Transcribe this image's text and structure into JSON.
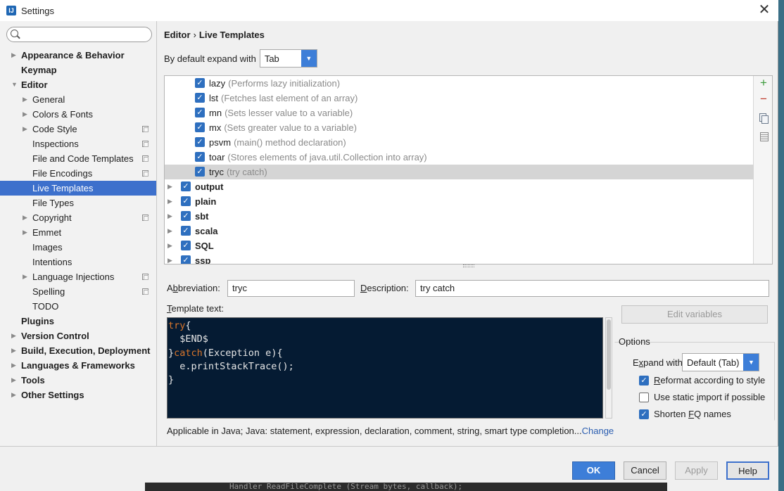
{
  "window": {
    "title": "Settings",
    "app_icon_glyph": "IJ",
    "close_glyph": "✕"
  },
  "search": {
    "placeholder": ""
  },
  "sidebar": {
    "items": [
      {
        "label": "Appearance & Behavior",
        "level": 0,
        "bold": true,
        "arrow": "right",
        "page_icon": false
      },
      {
        "label": "Keymap",
        "level": 0,
        "bold": true,
        "arrow": "none",
        "page_icon": false
      },
      {
        "label": "Editor",
        "level": 0,
        "bold": true,
        "arrow": "down",
        "page_icon": false
      },
      {
        "label": "General",
        "level": 1,
        "bold": false,
        "arrow": "right",
        "page_icon": false
      },
      {
        "label": "Colors & Fonts",
        "level": 1,
        "bold": false,
        "arrow": "right",
        "page_icon": false
      },
      {
        "label": "Code Style",
        "level": 1,
        "bold": false,
        "arrow": "right",
        "page_icon": true
      },
      {
        "label": "Inspections",
        "level": 1,
        "bold": false,
        "arrow": "none",
        "page_icon": true
      },
      {
        "label": "File and Code Templates",
        "level": 1,
        "bold": false,
        "arrow": "none",
        "page_icon": true
      },
      {
        "label": "File Encodings",
        "level": 1,
        "bold": false,
        "arrow": "none",
        "page_icon": true
      },
      {
        "label": "Live Templates",
        "level": 1,
        "bold": false,
        "arrow": "none",
        "page_icon": false,
        "selected": true
      },
      {
        "label": "File Types",
        "level": 1,
        "bold": false,
        "arrow": "none",
        "page_icon": false
      },
      {
        "label": "Copyright",
        "level": 1,
        "bold": false,
        "arrow": "right",
        "page_icon": true
      },
      {
        "label": "Emmet",
        "level": 1,
        "bold": false,
        "arrow": "right",
        "page_icon": false
      },
      {
        "label": "Images",
        "level": 1,
        "bold": false,
        "arrow": "none",
        "page_icon": false
      },
      {
        "label": "Intentions",
        "level": 1,
        "bold": false,
        "arrow": "none",
        "page_icon": false
      },
      {
        "label": "Language Injections",
        "level": 1,
        "bold": false,
        "arrow": "right",
        "page_icon": true
      },
      {
        "label": "Spelling",
        "level": 1,
        "bold": false,
        "arrow": "none",
        "page_icon": true
      },
      {
        "label": "TODO",
        "level": 1,
        "bold": false,
        "arrow": "none",
        "page_icon": false
      },
      {
        "label": "Plugins",
        "level": 0,
        "bold": true,
        "arrow": "none",
        "page_icon": false
      },
      {
        "label": "Version Control",
        "level": 0,
        "bold": true,
        "arrow": "right",
        "page_icon": false
      },
      {
        "label": "Build, Execution, Deployment",
        "level": 0,
        "bold": true,
        "arrow": "right",
        "page_icon": false
      },
      {
        "label": "Languages & Frameworks",
        "level": 0,
        "bold": true,
        "arrow": "right",
        "page_icon": false
      },
      {
        "label": "Tools",
        "level": 0,
        "bold": true,
        "arrow": "right",
        "page_icon": false
      },
      {
        "label": "Other Settings",
        "level": 0,
        "bold": true,
        "arrow": "right",
        "page_icon": false
      }
    ]
  },
  "breadcrumb": {
    "parent": "Editor",
    "separator": "›",
    "current": "Live Templates"
  },
  "expand": {
    "label": "By default expand with",
    "value": "Tab"
  },
  "templates": [
    {
      "name": "lazy",
      "desc": "(Performs lazy initialization)",
      "checked": true
    },
    {
      "name": "lst",
      "desc": "(Fetches last element of an array)",
      "checked": true
    },
    {
      "name": "mn",
      "desc": "(Sets lesser value to a variable)",
      "checked": true
    },
    {
      "name": "mx",
      "desc": "(Sets greater value to a variable)",
      "checked": true
    },
    {
      "name": "psvm",
      "desc": "(main() method declaration)",
      "checked": true
    },
    {
      "name": "toar",
      "desc": "(Stores elements of java.util.Collection into array)",
      "checked": true
    },
    {
      "name": "tryc",
      "desc": "(try catch)",
      "checked": true,
      "selected": true
    }
  ],
  "groups": [
    {
      "name": "output",
      "checked": true
    },
    {
      "name": "plain",
      "checked": true
    },
    {
      "name": "sbt",
      "checked": true
    },
    {
      "name": "scala",
      "checked": true
    },
    {
      "name": "SQL",
      "checked": true
    },
    {
      "name": "ssp",
      "checked": true
    }
  ],
  "toolbar": {
    "add_glyph": "+",
    "remove_glyph": "−"
  },
  "form": {
    "abbreviation_label_pre": "A",
    "abbreviation_label_u": "b",
    "abbreviation_label_post": "breviation:",
    "abbreviation_value": "tryc",
    "description_label_u": "D",
    "description_label_post": "escription:",
    "description_value": "try catch",
    "template_text_label_u": "T",
    "template_text_label_post": "emplate text:",
    "edit_variables": "Edit variables"
  },
  "code": {
    "lines": [
      [
        {
          "t": "try",
          "kw": true
        },
        {
          "t": "{",
          "kw": false
        }
      ],
      [
        {
          "t": "  $END$",
          "kw": false
        }
      ],
      [
        {
          "t": "}",
          "kw": false
        },
        {
          "t": "catch",
          "kw": true
        },
        {
          "t": "(Exception e){",
          "kw": false
        }
      ],
      [
        {
          "t": "  e.printStackTrace();",
          "kw": false
        }
      ],
      [
        {
          "t": "}",
          "kw": false
        }
      ]
    ]
  },
  "options": {
    "title": "Options",
    "expand_with_label_pre": "E",
    "expand_with_label_u": "x",
    "expand_with_label_post": "pand with",
    "expand_with_value": "Default (Tab)",
    "reformat_u": "R",
    "reformat_post": "eformat according to style",
    "reformat_checked": true,
    "static_import_pre": "Use static ",
    "static_import_u": "i",
    "static_import_post": "mport if possible",
    "static_import_checked": false,
    "shorten_pre": "Shorten ",
    "shorten_u": "F",
    "shorten_post": "Q names",
    "shorten_checked": true
  },
  "applicable": {
    "text": "Applicable in Java; Java: statement, expression, declaration, comment, string, smart type completion...",
    "link": "Change"
  },
  "footer": {
    "ok": "OK",
    "cancel": "Cancel",
    "apply": "Apply",
    "help": "Help"
  },
  "desktop": {
    "text": "Handler  ReadFileComplete (Stream bytes, callback);"
  },
  "colors": {
    "accent": "#3d70cc",
    "keyword": "#d9762b",
    "code_bg": "#051b33",
    "add": "#3c9b3c",
    "remove": "#c0392b"
  }
}
